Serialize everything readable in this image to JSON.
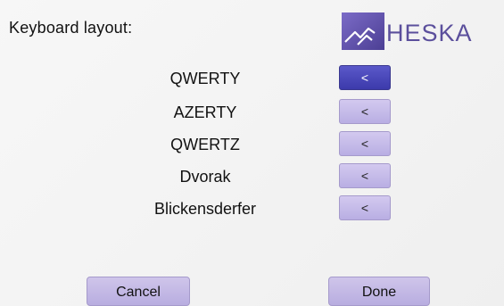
{
  "header": {
    "title": "Keyboard layout:",
    "logo_text": "HESKA"
  },
  "layouts": [
    {
      "label": "QWERTY",
      "button_label": "<",
      "selected": true
    },
    {
      "label": "AZERTY",
      "button_label": "<",
      "selected": false
    },
    {
      "label": "QWERTZ",
      "button_label": "<",
      "selected": false
    },
    {
      "label": "Dvorak",
      "button_label": "<",
      "selected": false
    },
    {
      "label": "Blickensderfer",
      "button_label": "<",
      "selected": false
    }
  ],
  "footer": {
    "cancel_label": "Cancel",
    "done_label": "Done"
  },
  "colors": {
    "selected_button": "#4a48bb",
    "button": "#c4b9ea",
    "brand": "#5b4f9c"
  }
}
